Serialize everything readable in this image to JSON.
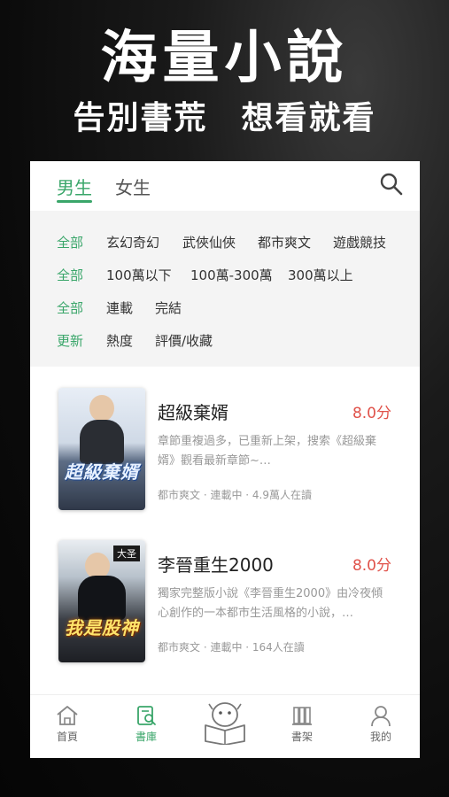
{
  "promo": {
    "title": "海量小說",
    "subtitle_left": "告別書荒",
    "subtitle_right": "想看就看"
  },
  "tabs": [
    {
      "label": "男生",
      "active": true
    },
    {
      "label": "女生",
      "active": false
    }
  ],
  "filters": {
    "row1": [
      "全部",
      "玄幻奇幻",
      "武俠仙俠",
      "都市爽文",
      "遊戲競技"
    ],
    "row2": [
      "全部",
      "100萬以下",
      "100萬-300萬",
      "300萬以上"
    ],
    "row3": [
      "全部",
      "連載",
      "完結"
    ],
    "row4": [
      "更新",
      "熱度",
      "評價/收藏"
    ]
  },
  "books": [
    {
      "title": "超級棄婿",
      "score": "8.0分",
      "description": "章節重複過多，已重新上架，搜索《超級棄婿》觀看最新章節~…",
      "meta": "都市爽文 · 連載中 · 4.9萬人在讀",
      "cover_text": "超級棄婿"
    },
    {
      "title": "李晉重生2000",
      "score": "8.0分",
      "description": "獨家完整版小說《李晉重生2000》由冷夜傾心創作的一本都市生活風格的小說，…",
      "meta": "都市爽文 · 連載中 · 164人在讀",
      "cover_text": "我是股神",
      "cover_badge": "大圣"
    }
  ],
  "nav": {
    "home": "首頁",
    "library": "書庫",
    "shelf": "書架",
    "me": "我的"
  },
  "colors": {
    "accent": "#3aa66a",
    "score": "#e0524a"
  }
}
